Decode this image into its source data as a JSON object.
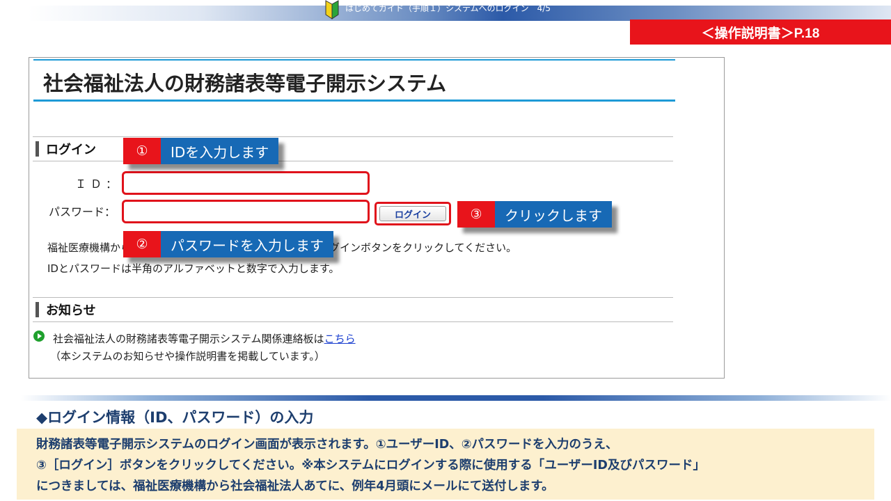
{
  "banner": {
    "title": "はじめてガイド（手順１）システムへのログイン　4/5",
    "icon": "beginner-leaf-icon"
  },
  "manual_ref": "＜操作説明書＞P.18",
  "system": {
    "title": "社会福祉法人の財務諸表等電子開示システム",
    "login_section": "ログイン",
    "id_label": "ＩＤ：",
    "id_value": "",
    "password_label": "パスワード：",
    "password_value": "",
    "login_button": "ログイン",
    "desc_line1": "福祉医療機構から付与されたＩＤとパスワードを入力し、ログインボタンをクリックしてください。",
    "desc_line2": "IDとパスワードは半角のアルファベットと数字で入力します。",
    "notice_section": "お知らせ",
    "notice_text": "社会福祉法人の財務諸表等電子開示システム関係連絡板は",
    "notice_link": "こちら",
    "notice_sub": "（本システムのお知らせや操作説明書を掲載しています。）"
  },
  "callouts": [
    {
      "num": "①",
      "text": "IDを入力します"
    },
    {
      "num": "②",
      "text": "パスワードを入力します"
    },
    {
      "num": "③",
      "text": "クリックします"
    }
  ],
  "section_heading": "◆ログイン情報（ID、パスワード）の入力",
  "info_lines": [
    "財務諸表等電子開示システムのログイン画面が表示されます。①ユーザーID、②パスワードを入力のうえ、",
    "③［ログイン］ボタンをクリックしてください。※本システムにログインする際に使用する「ユーザーID及びパスワード」",
    "につきましては、福祉医療機構から社会福祉法人あてに、例年4月頭にメールにて送付します。"
  ],
  "colors": {
    "accent_red": "#e8141b",
    "callout_blue": "#1769b5",
    "title_line_blue": "#1d9ad6",
    "heading_navy": "#1d3e6e",
    "info_bg": "#fdf0cf"
  }
}
